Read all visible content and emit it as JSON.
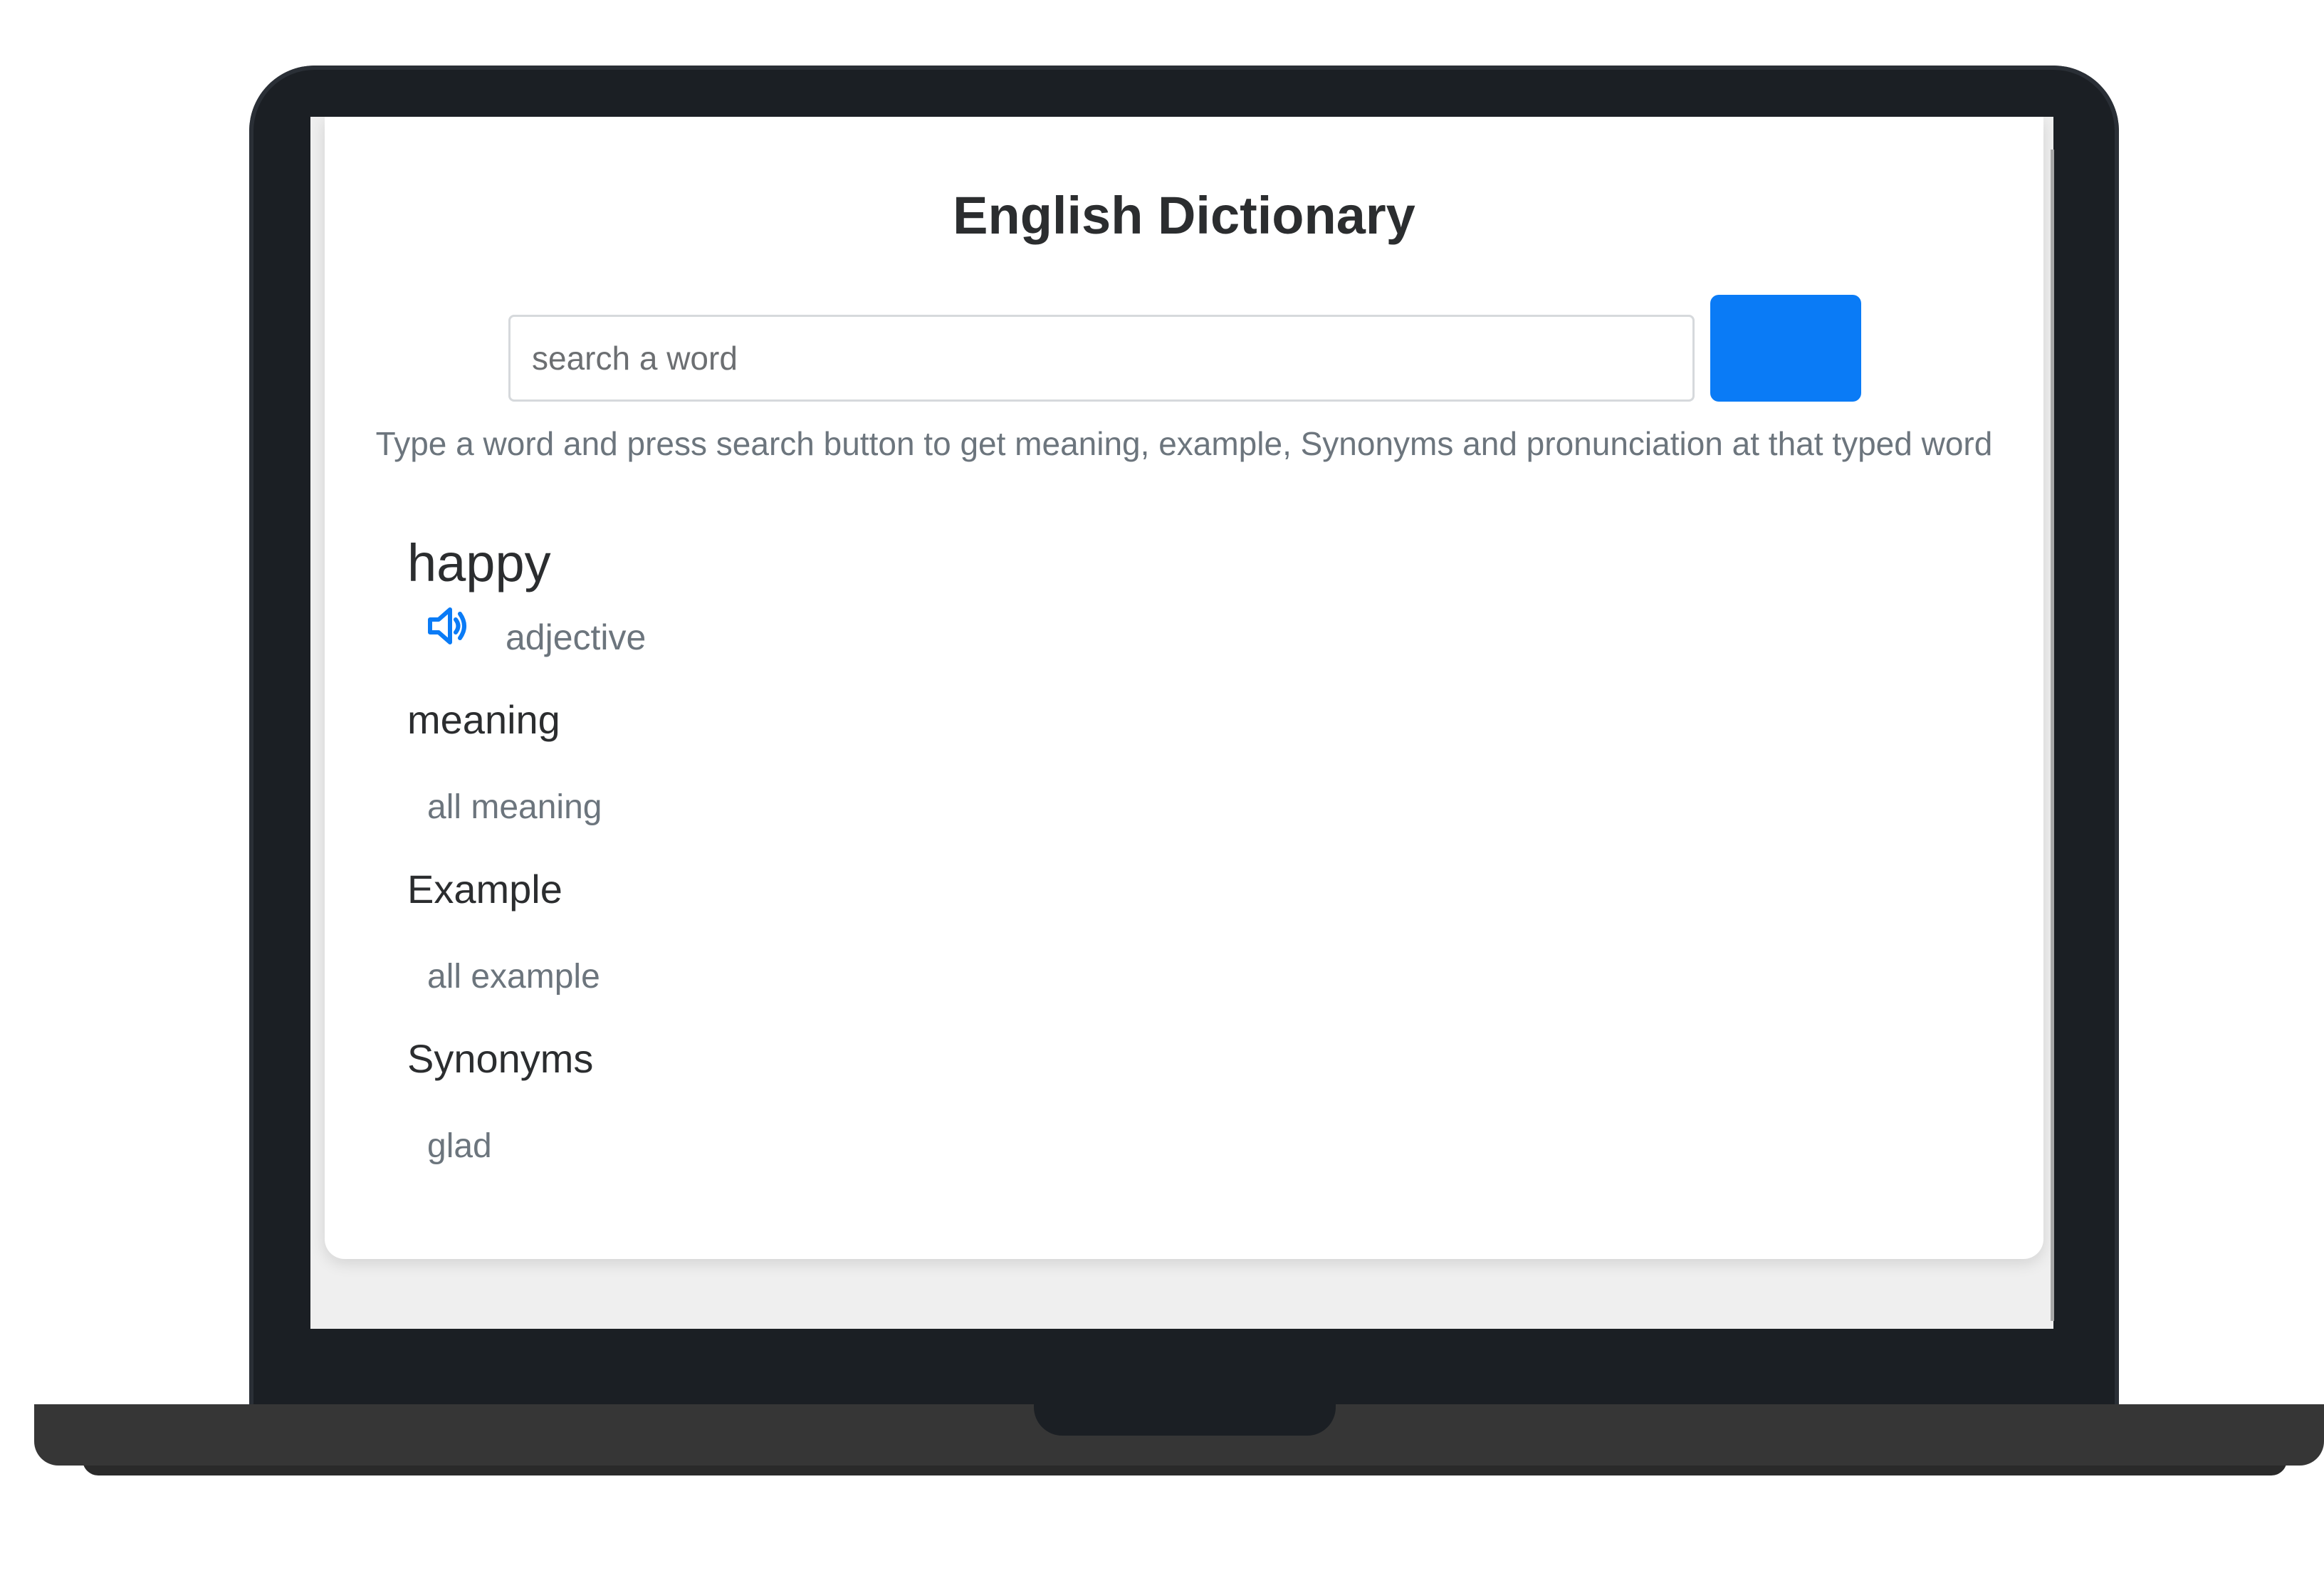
{
  "app": {
    "title": "English Dictionary"
  },
  "search": {
    "placeholder": "search a word",
    "value": "",
    "button_color": "#0a7bf6"
  },
  "hint": "Type a word and press search button to get meaning, example, Synonyms and pronunciation at that typed word",
  "result": {
    "word": "happy",
    "audio_icon": "speaker-icon",
    "part_of_speech": "adjective",
    "sections": [
      {
        "heading": "meaning",
        "value": "all meaning"
      },
      {
        "heading": "Example",
        "value": "all example"
      },
      {
        "heading": "Synonyms",
        "value": "glad"
      }
    ]
  },
  "colors": {
    "accent": "#0a7bf6",
    "bezel": "#1b1f24",
    "muted_text": "#6c757d"
  }
}
